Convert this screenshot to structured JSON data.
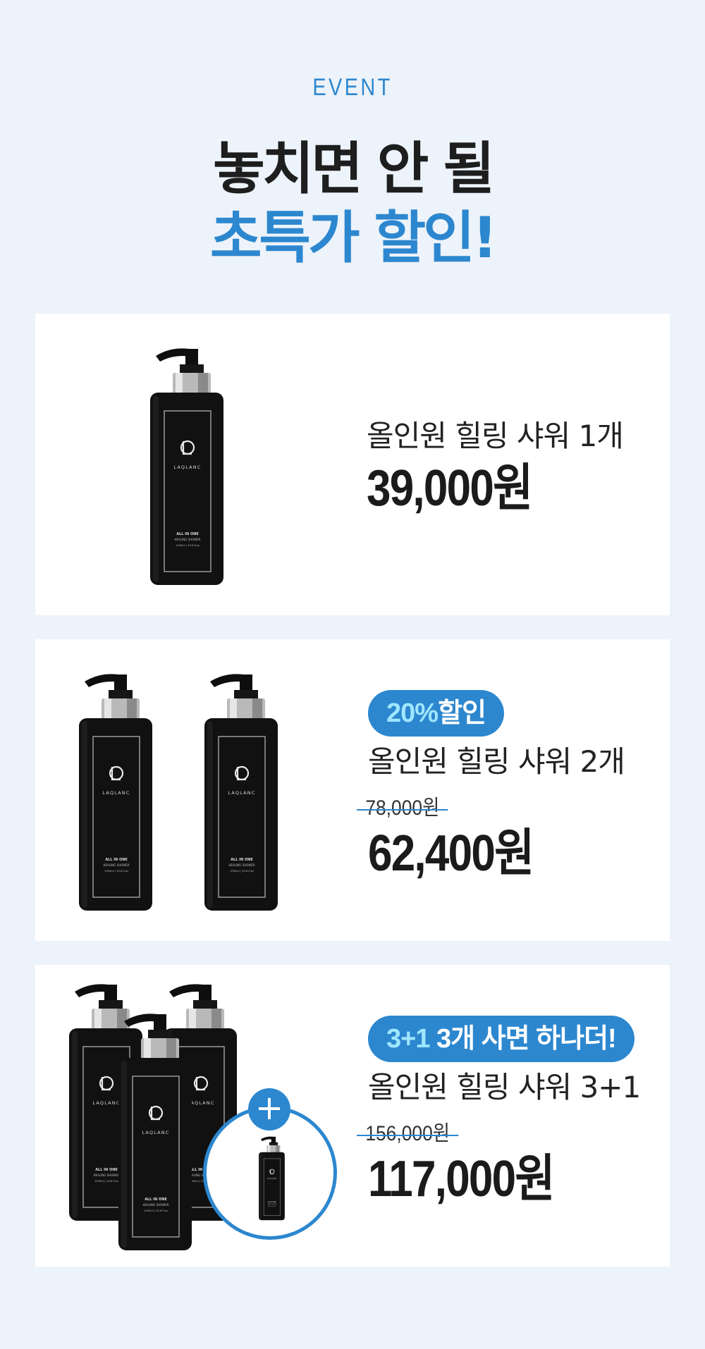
{
  "header": {
    "eyebrow": "EVENT",
    "title_line1": "놓치면 안 될",
    "title_line2": "초특가 할인!"
  },
  "bottle_label": {
    "brand": "LAQLANC",
    "line1": "ALL IN ONE",
    "line2": "HEALING SHOWER",
    "line3": "1000ml | 33.8 fl.oz"
  },
  "offers": [
    {
      "name": "올인원 힐링 샤워 1개",
      "price": "39,000원"
    },
    {
      "badge_highlight": "20%",
      "badge_text": "할인",
      "name": "올인원 힐링 샤워 2개",
      "original_price": "78,000원",
      "price": "62,400원"
    },
    {
      "badge_highlight": "3+1",
      "badge_text": " 3개 사면 하나더!",
      "name": "올인원 힐링 샤워 3+1",
      "original_price": "156,000원",
      "price": "117,000원",
      "bonus_icon": "plus-icon",
      "bonus_symbol": "+"
    }
  ],
  "colors": {
    "accent": "#2c87cf",
    "badge_highlight": "#9fe6ff",
    "background": "#edf3fa",
    "card": "#ffffff",
    "bottle": "#111111",
    "text": "#1e1e1e"
  }
}
